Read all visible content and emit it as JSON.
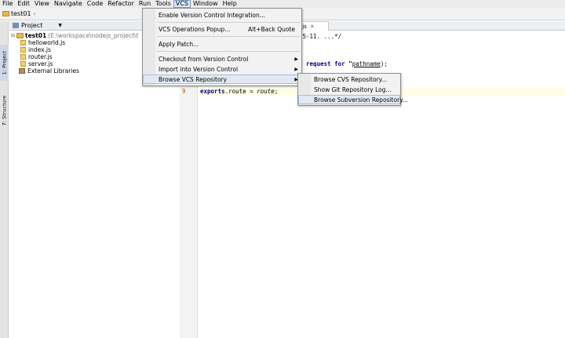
{
  "menubar": {
    "items": [
      "File",
      "Edit",
      "View",
      "Navigate",
      "Code",
      "Refactor",
      "Run",
      "Tools",
      "VCS",
      "Window",
      "Help"
    ],
    "active_index": 8
  },
  "navbar": {
    "project": "test01"
  },
  "left_strip": {
    "project_tab": "1: Project",
    "structure_tab": "7: Structure"
  },
  "project_panel": {
    "header": "Project",
    "tree": {
      "root": {
        "name": "test01",
        "path": "(E:\\workspace\\nodejs_project\\t"
      },
      "files": [
        "helloworld.js",
        "index.js",
        "router.js",
        "server.js"
      ],
      "external": "External Libraries"
    }
  },
  "editor": {
    "tab_label": ".js",
    "line_number": "9",
    "code": {
      "line1": "05-11. ...*/",
      "line2_prefix": "a request for \"",
      "line2_prop": "pathname",
      "line2_suffix": ");",
      "line9_kw": "exports",
      "line9_mid": ".route = ",
      "line9_val": "route",
      "line9_end": ";"
    }
  },
  "vcs_menu": {
    "items": [
      {
        "label": "Enable Version Control Integration...",
        "shortcut": ""
      },
      {
        "label": "VCS Operations Popup...",
        "shortcut": "Alt+Back Quote"
      },
      {
        "label": "Apply Patch...",
        "shortcut": ""
      },
      {
        "label": "Checkout from Version Control",
        "shortcut": ""
      },
      {
        "label": "Import into Version Control",
        "shortcut": ""
      },
      {
        "label": "Browse VCS Repository",
        "shortcut": ""
      }
    ]
  },
  "browse_submenu": {
    "items": [
      "Browse CVS Repository...",
      "Show Git Repository Log...",
      "Browse Subversion Repository..."
    ]
  },
  "colors": {
    "highlight": "#e2e9f3",
    "line_number": "#c25a00",
    "keyword": "#000080"
  }
}
